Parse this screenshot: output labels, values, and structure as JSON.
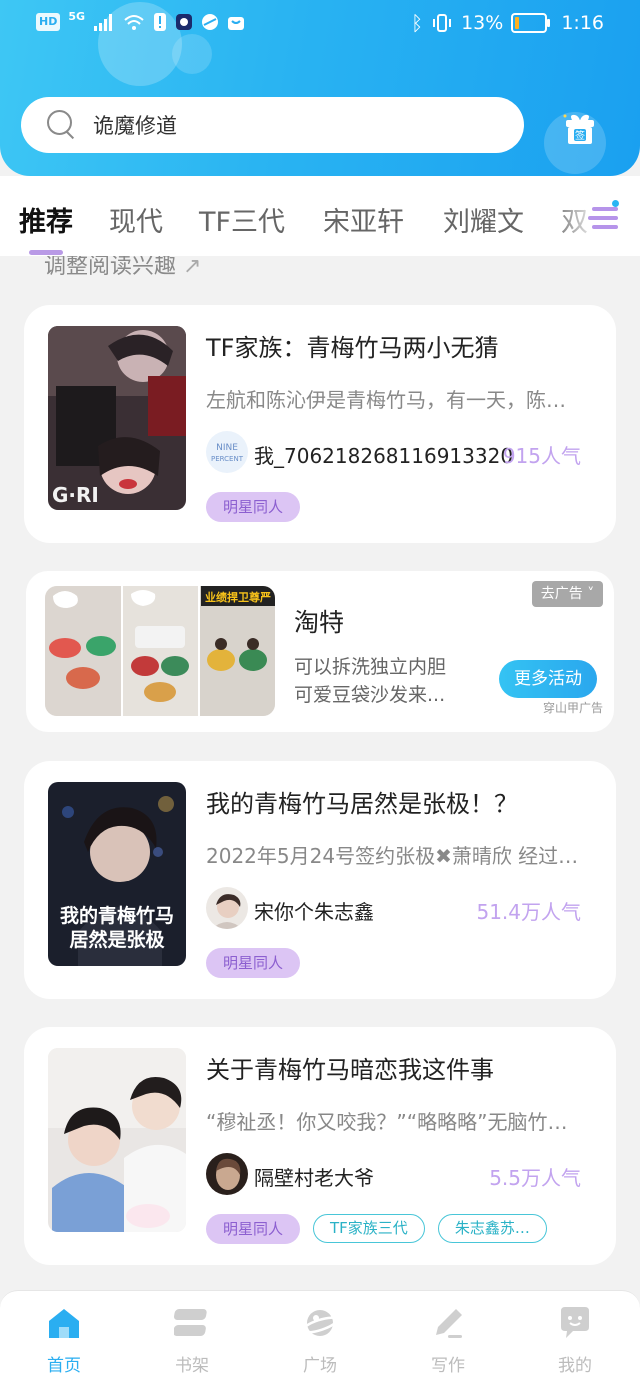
{
  "status_bar": {
    "left_chips": [
      "HD",
      "5G"
    ],
    "battery_text": "13%",
    "battery_level": 0.13,
    "time": "1:16"
  },
  "search": {
    "text": "诡魔修道"
  },
  "checkin_label": "签",
  "tabs": {
    "items": [
      "推荐",
      "现代",
      "TF三代",
      "宋亚轩",
      "刘耀文",
      "双"
    ],
    "active_index": 0
  },
  "interest_link": "调整阅读兴趣",
  "books": [
    {
      "title": "TF家族：青梅竹马两小无猜",
      "desc": "左航和陈沁伊是青梅竹马，有一天，陈…",
      "author": "我_706218268116913320",
      "popularity": "915人气",
      "tags": [
        "明星同人"
      ]
    },
    {
      "title": "我的青梅竹马居然是张极！？",
      "desc": "2022年5月24号签约张极✖萧晴欣 经过…",
      "author": "宋你个朱志鑫",
      "popularity": "51.4万人气",
      "cover_text": "我的青梅竹马居然是张极",
      "tags": [
        "明星同人"
      ]
    },
    {
      "title": "关于青梅竹马暗恋我这件事",
      "desc": "“穆祉丞！你又咬我？”“略略略”无脑竹…",
      "author": "隔壁村老大爷",
      "popularity": "5.5万人气",
      "tags": [
        "明星同人",
        "TF家族三代",
        "朱志鑫苏…"
      ]
    }
  ],
  "avatar_badge": {
    "line1": "NINE",
    "line2": "PERCENT"
  },
  "ad": {
    "title": "淘特",
    "desc": "可以拆洗独立内胆可爱豆袋沙发来...",
    "button": "更多活动",
    "close": "去广告 ˅",
    "source": "穿山甲广告",
    "image_caption": "业绩捍卫尊严"
  },
  "bottom_nav": [
    {
      "label": "首页",
      "icon": "home-icon",
      "active": true
    },
    {
      "label": "书架",
      "icon": "bookshelf-icon",
      "active": false
    },
    {
      "label": "广场",
      "icon": "planet-icon",
      "active": false
    },
    {
      "label": "写作",
      "icon": "pen-icon",
      "active": false
    },
    {
      "label": "我的",
      "icon": "chat-bubble-icon",
      "active": false
    }
  ],
  "colors": {
    "accent_blue": "#2aaef1",
    "accent_purple": "#b99ae6",
    "popularity_purple": "#c2a3ef"
  }
}
